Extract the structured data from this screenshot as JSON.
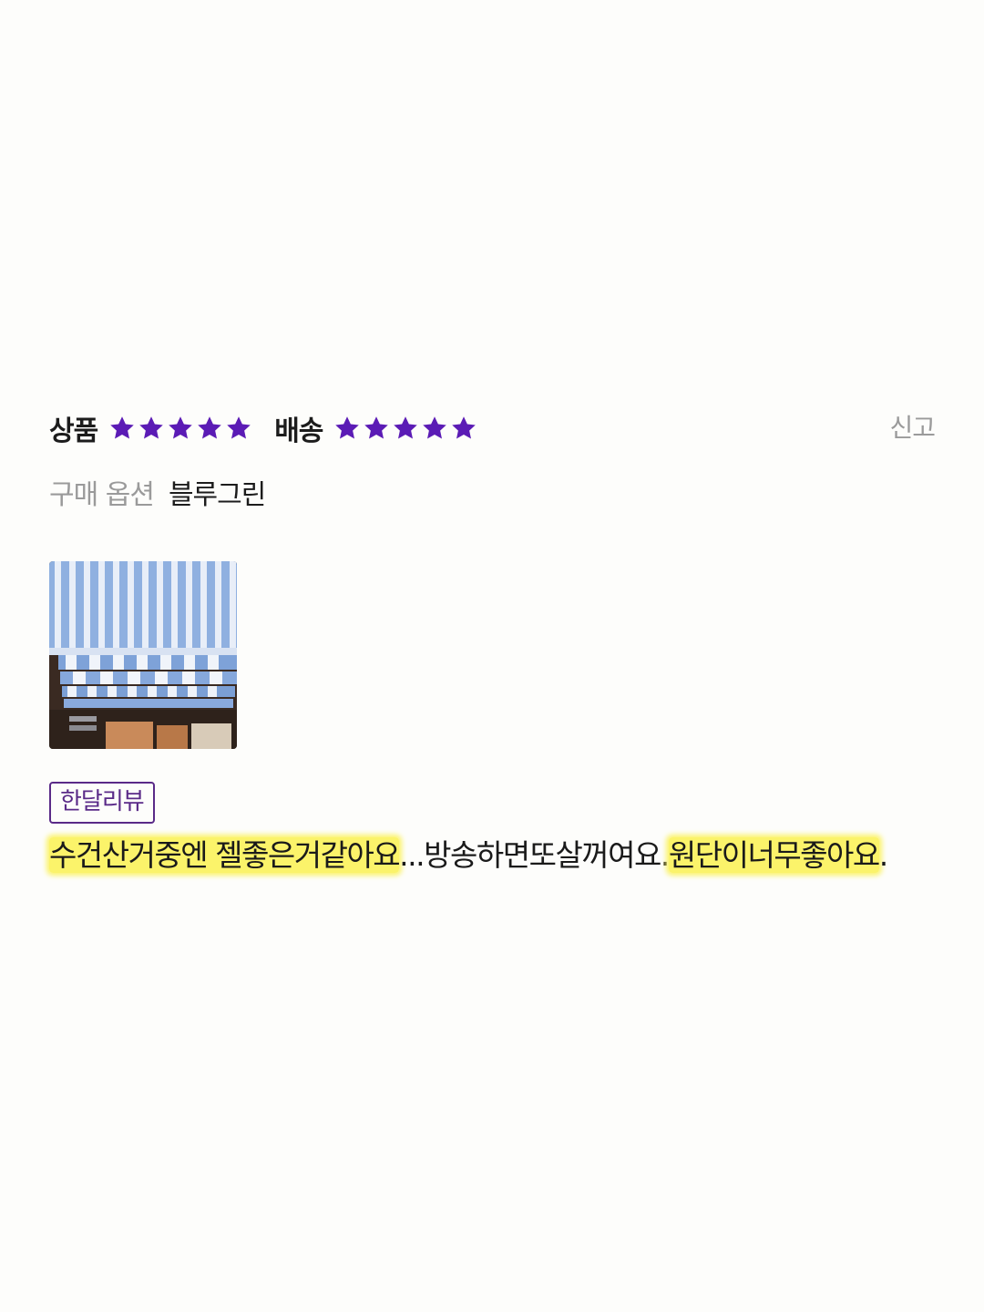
{
  "review": {
    "product_rating": {
      "label": "상품",
      "stars": 5,
      "max": 5
    },
    "delivery_rating": {
      "label": "배송",
      "stars": 5,
      "max": 5
    },
    "report_label": "신고",
    "option_label": "구매 옵션",
    "option_value": "블루그린",
    "photo_icon": "striped-towel-photo",
    "badge_label": "한달리뷰",
    "text_segments": [
      {
        "text": "수건산거중엔 젤좋은거같아요",
        "highlight": true
      },
      {
        "text": "...방송하면또살꺼여요.",
        "highlight": false
      },
      {
        "text": "원단이너무좋아요",
        "highlight": true
      },
      {
        "text": ".",
        "highlight": false
      }
    ]
  },
  "colors": {
    "star": "#5b1bb5",
    "badge": "#5a2a88",
    "highlight": "#fbf36a",
    "muted_text": "#9a9a9a",
    "background": "#fdfdfb"
  }
}
